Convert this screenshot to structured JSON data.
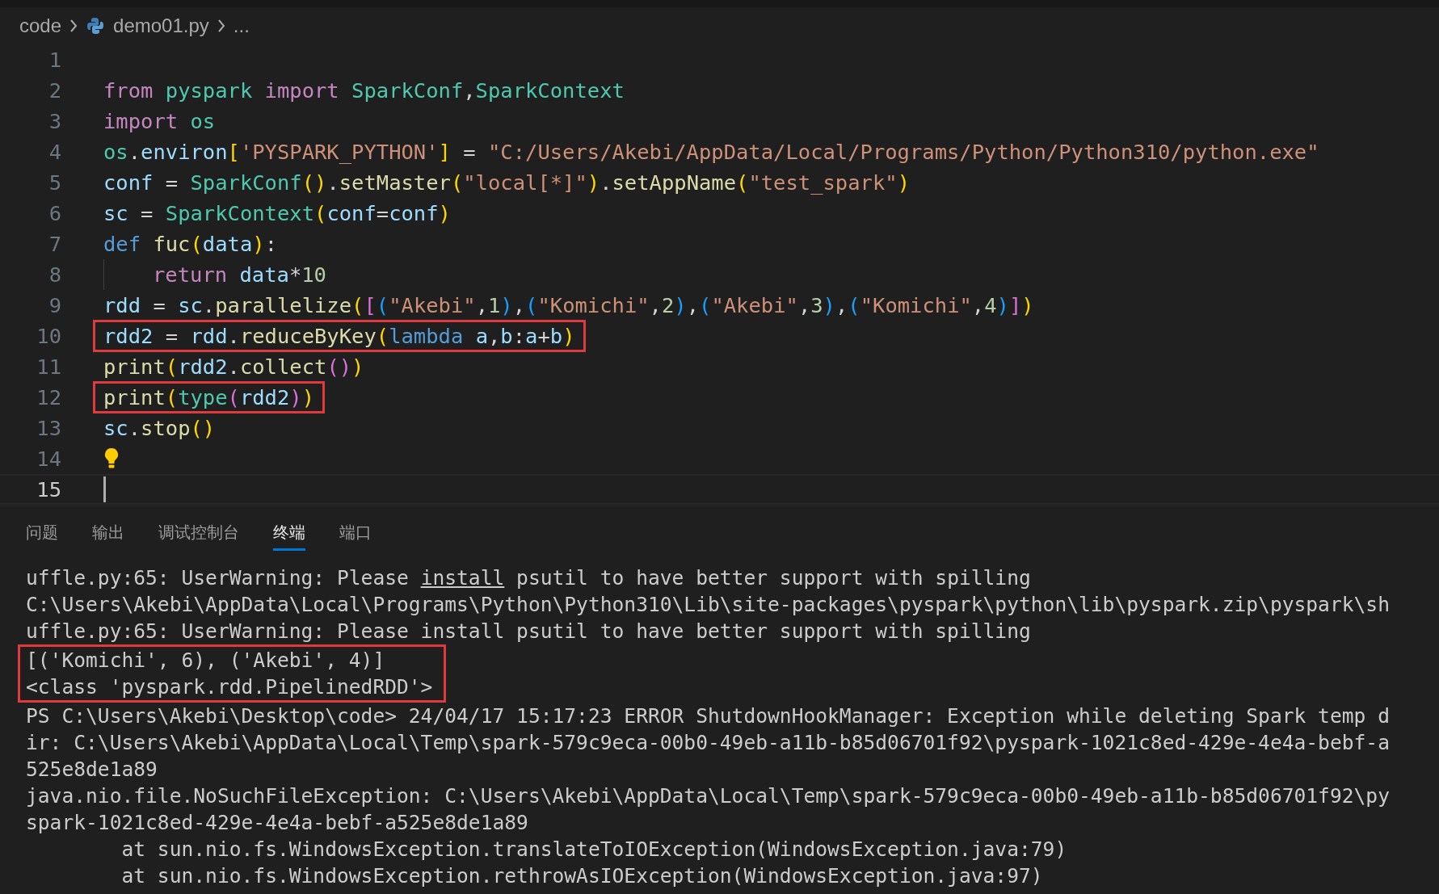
{
  "breadcrumb": {
    "folder": "code",
    "file": "demo01.py",
    "more": "..."
  },
  "editor": {
    "lines": [
      {
        "number": "1",
        "kind": "blank"
      },
      {
        "number": "2",
        "kind": "code",
        "highlighted": false,
        "tokens": [
          {
            "text": "from",
            "kind": "kw"
          },
          {
            "text": " pyspark",
            "kind": "cls"
          },
          {
            "text": " import",
            "kind": "kw"
          },
          {
            "text": " SparkConf",
            "kind": "cls"
          },
          {
            "text": ",",
            "kind": "op"
          },
          {
            "text": "SparkContext",
            "kind": "cls"
          }
        ]
      },
      {
        "number": "3",
        "kind": "code",
        "highlighted": false,
        "tokens": [
          {
            "text": "import",
            "kind": "kw"
          },
          {
            "text": " os",
            "kind": "cls"
          }
        ]
      },
      {
        "number": "4",
        "kind": "code",
        "highlighted": false,
        "tokens": [
          {
            "text": "os",
            "kind": "cls"
          },
          {
            "text": ".",
            "kind": "op"
          },
          {
            "text": "environ",
            "kind": "var"
          },
          {
            "text": "[",
            "kind": "br1"
          },
          {
            "text": "'PYSPARK_PYTHON'",
            "kind": "str"
          },
          {
            "text": "]",
            "kind": "br1"
          },
          {
            "text": " = ",
            "kind": "op"
          },
          {
            "text": "\"C:/Users/Akebi/AppData/Local/Programs/Python/Python310/python.exe\"",
            "kind": "str"
          }
        ]
      },
      {
        "number": "5",
        "kind": "code",
        "highlighted": false,
        "tokens": [
          {
            "text": "conf",
            "kind": "var"
          },
          {
            "text": " = ",
            "kind": "op"
          },
          {
            "text": "SparkConf",
            "kind": "cls"
          },
          {
            "text": "()",
            "kind": "br1"
          },
          {
            "text": ".",
            "kind": "op"
          },
          {
            "text": "setMaster",
            "kind": "fn"
          },
          {
            "text": "(",
            "kind": "br1"
          },
          {
            "text": "\"local[*]\"",
            "kind": "str"
          },
          {
            "text": ")",
            "kind": "br1"
          },
          {
            "text": ".",
            "kind": "op"
          },
          {
            "text": "setAppName",
            "kind": "fn"
          },
          {
            "text": "(",
            "kind": "br1"
          },
          {
            "text": "\"test_spark\"",
            "kind": "str"
          },
          {
            "text": ")",
            "kind": "br1"
          }
        ]
      },
      {
        "number": "6",
        "kind": "code",
        "highlighted": false,
        "tokens": [
          {
            "text": "sc",
            "kind": "var"
          },
          {
            "text": " = ",
            "kind": "op"
          },
          {
            "text": "SparkContext",
            "kind": "cls"
          },
          {
            "text": "(",
            "kind": "br1"
          },
          {
            "text": "conf",
            "kind": "var"
          },
          {
            "text": "=",
            "kind": "op"
          },
          {
            "text": "conf",
            "kind": "var"
          },
          {
            "text": ")",
            "kind": "br1"
          }
        ]
      },
      {
        "number": "7",
        "kind": "code",
        "highlighted": false,
        "tokens": [
          {
            "text": "def",
            "kind": "def"
          },
          {
            "text": " fuc",
            "kind": "fn"
          },
          {
            "text": "(",
            "kind": "br1"
          },
          {
            "text": "data",
            "kind": "var"
          },
          {
            "text": ")",
            "kind": "br1"
          },
          {
            "text": ":",
            "kind": "op"
          }
        ]
      },
      {
        "number": "8",
        "kind": "indented",
        "highlighted": false,
        "tokens": [
          {
            "text": "return",
            "kind": "kw"
          },
          {
            "text": " data",
            "kind": "var"
          },
          {
            "text": "*",
            "kind": "op"
          },
          {
            "text": "10",
            "kind": "num"
          }
        ]
      },
      {
        "number": "9",
        "kind": "code",
        "highlighted": false,
        "tokens": [
          {
            "text": "rdd",
            "kind": "var"
          },
          {
            "text": " = ",
            "kind": "op"
          },
          {
            "text": "sc",
            "kind": "var"
          },
          {
            "text": ".",
            "kind": "op"
          },
          {
            "text": "parallelize",
            "kind": "fn"
          },
          {
            "text": "(",
            "kind": "br1"
          },
          {
            "text": "[",
            "kind": "br2"
          },
          {
            "text": "(",
            "kind": "br3"
          },
          {
            "text": "\"Akebi\"",
            "kind": "str"
          },
          {
            "text": ",",
            "kind": "op"
          },
          {
            "text": "1",
            "kind": "num"
          },
          {
            "text": ")",
            "kind": "br3"
          },
          {
            "text": ",",
            "kind": "op"
          },
          {
            "text": "(",
            "kind": "br3"
          },
          {
            "text": "\"Komichi\"",
            "kind": "str"
          },
          {
            "text": ",",
            "kind": "op"
          },
          {
            "text": "2",
            "kind": "num"
          },
          {
            "text": ")",
            "kind": "br3"
          },
          {
            "text": ",",
            "kind": "op"
          },
          {
            "text": "(",
            "kind": "br3"
          },
          {
            "text": "\"Akebi\"",
            "kind": "str"
          },
          {
            "text": ",",
            "kind": "op"
          },
          {
            "text": "3",
            "kind": "num"
          },
          {
            "text": ")",
            "kind": "br3"
          },
          {
            "text": ",",
            "kind": "op"
          },
          {
            "text": "(",
            "kind": "br3"
          },
          {
            "text": "\"Komichi\"",
            "kind": "str"
          },
          {
            "text": ",",
            "kind": "op"
          },
          {
            "text": "4",
            "kind": "num"
          },
          {
            "text": ")",
            "kind": "br3"
          },
          {
            "text": "]",
            "kind": "br2"
          },
          {
            "text": ")",
            "kind": "br1"
          }
        ]
      },
      {
        "number": "10",
        "kind": "code",
        "highlighted": true,
        "tokens": [
          {
            "text": "rdd2",
            "kind": "var"
          },
          {
            "text": " = ",
            "kind": "op"
          },
          {
            "text": "rdd",
            "kind": "var"
          },
          {
            "text": ".",
            "kind": "op"
          },
          {
            "text": "reduceByKey",
            "kind": "fn"
          },
          {
            "text": "(",
            "kind": "br1"
          },
          {
            "text": "lambda",
            "kind": "def"
          },
          {
            "text": " a",
            "kind": "var"
          },
          {
            "text": ",",
            "kind": "op"
          },
          {
            "text": "b",
            "kind": "var"
          },
          {
            "text": ":",
            "kind": "op"
          },
          {
            "text": "a",
            "kind": "var"
          },
          {
            "text": "+",
            "kind": "op"
          },
          {
            "text": "b",
            "kind": "var"
          },
          {
            "text": ")",
            "kind": "br1"
          }
        ]
      },
      {
        "number": "11",
        "kind": "code",
        "highlighted": false,
        "tokens": [
          {
            "text": "print",
            "kind": "fn"
          },
          {
            "text": "(",
            "kind": "br1"
          },
          {
            "text": "rdd2",
            "kind": "var"
          },
          {
            "text": ".",
            "kind": "op"
          },
          {
            "text": "collect",
            "kind": "fn"
          },
          {
            "text": "()",
            "kind": "br2"
          },
          {
            "text": ")",
            "kind": "br1"
          }
        ]
      },
      {
        "number": "12",
        "kind": "code",
        "highlighted": true,
        "tokens": [
          {
            "text": "print",
            "kind": "fn"
          },
          {
            "text": "(",
            "kind": "br1"
          },
          {
            "text": "type",
            "kind": "cls"
          },
          {
            "text": "(",
            "kind": "br2"
          },
          {
            "text": "rdd2",
            "kind": "var"
          },
          {
            "text": ")",
            "kind": "br2"
          },
          {
            "text": ")",
            "kind": "br1"
          }
        ]
      },
      {
        "number": "13",
        "kind": "code",
        "highlighted": false,
        "tokens": [
          {
            "text": "sc",
            "kind": "var"
          },
          {
            "text": ".",
            "kind": "op"
          },
          {
            "text": "stop",
            "kind": "fn"
          },
          {
            "text": "()",
            "kind": "br1"
          }
        ]
      },
      {
        "number": "14",
        "kind": "lightbulb"
      },
      {
        "number": "15",
        "kind": "cursor"
      }
    ]
  },
  "panel": {
    "tabs": [
      {
        "label": "问题",
        "selected": false
      },
      {
        "label": "输出",
        "selected": false
      },
      {
        "label": "调试控制台",
        "selected": false
      },
      {
        "label": "终端",
        "selected": true
      },
      {
        "label": "端口",
        "selected": false
      }
    ],
    "terminal": [
      {
        "highlighted": false,
        "parts": [
          {
            "text": "uffle.py:65: UserWarning: Please ",
            "kind": "text"
          },
          {
            "text": "install",
            "kind": "link"
          },
          {
            "text": " psutil to have better support with spilling",
            "kind": "text"
          }
        ]
      },
      {
        "highlighted": false,
        "parts": [
          {
            "text": "C:\\Users\\Akebi\\AppData\\Local\\Programs\\Python\\Python310\\Lib\\site-packages\\pyspark\\python\\lib\\pyspark.zip\\pyspark\\sh",
            "kind": "text"
          }
        ]
      },
      {
        "highlighted": false,
        "parts": [
          {
            "text": "uffle.py:65: UserWarning: Please install psutil to have better support with spilling",
            "kind": "text"
          }
        ]
      },
      {
        "highlighted": true,
        "parts": [
          {
            "text": "[('Komichi', 6), ('Akebi', 4)]",
            "kind": "text"
          }
        ]
      },
      {
        "highlighted": true,
        "parts": [
          {
            "text": "<class 'pyspark.rdd.PipelinedRDD'>",
            "kind": "text"
          }
        ]
      },
      {
        "highlighted": false,
        "parts": [
          {
            "text": "PS C:\\Users\\Akebi\\Desktop\\code> 24/04/17 15:17:23 ERROR ShutdownHookManager: Exception while deleting Spark temp d",
            "kind": "text"
          }
        ]
      },
      {
        "highlighted": false,
        "parts": [
          {
            "text": "ir: C:\\Users\\Akebi\\AppData\\Local\\Temp\\spark-579c9eca-00b0-49eb-a11b-b85d06701f92\\pyspark-1021c8ed-429e-4e4a-bebf-a",
            "kind": "text"
          }
        ]
      },
      {
        "highlighted": false,
        "parts": [
          {
            "text": "525e8de1a89",
            "kind": "text"
          }
        ]
      },
      {
        "highlighted": false,
        "parts": [
          {
            "text": "java.nio.file.NoSuchFileException: C:\\Users\\Akebi\\AppData\\Local\\Temp\\spark-579c9eca-00b0-49eb-a11b-b85d06701f92\\py",
            "kind": "text"
          }
        ]
      },
      {
        "highlighted": false,
        "parts": [
          {
            "text": "spark-1021c8ed-429e-4e4a-bebf-a525e8de1a89",
            "kind": "text"
          }
        ]
      },
      {
        "highlighted": false,
        "parts": [
          {
            "text": "        at sun.nio.fs.WindowsException.translateToIOException(WindowsException.java:79)",
            "kind": "text"
          }
        ]
      },
      {
        "highlighted": false,
        "parts": [
          {
            "text": "        at sun.nio.fs.WindowsException.rethrowAsIOException(WindowsException.java:97)",
            "kind": "text"
          }
        ]
      }
    ]
  }
}
